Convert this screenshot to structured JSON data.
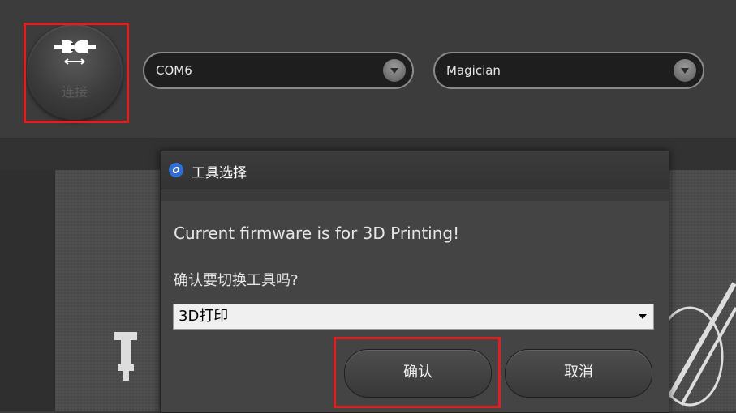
{
  "toolbar": {
    "connect_label": "连接",
    "port_select": {
      "value": "COM6"
    },
    "device_select": {
      "value": "Magician"
    }
  },
  "dialog": {
    "title": "工具选择",
    "message": "Current firmware is for 3D Printing!",
    "question": "确认要切换工具吗?",
    "tool_select": {
      "value": "3D打印"
    },
    "confirm_label": "确认",
    "cancel_label": "取消"
  },
  "colors": {
    "highlight": "#e02020",
    "background": "#3c3c3c",
    "dialog": "#444444"
  }
}
